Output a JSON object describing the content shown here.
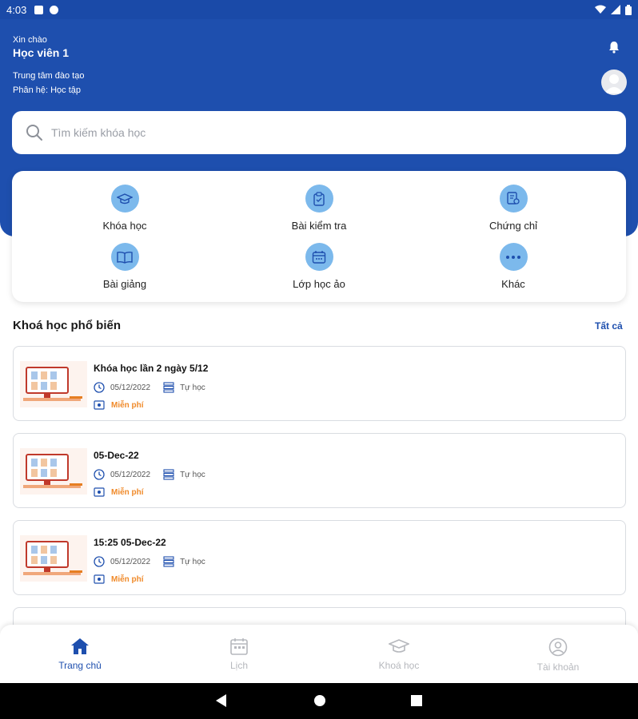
{
  "status_bar": {
    "time": "4:03"
  },
  "header": {
    "greeting": "Xin chào",
    "username": "Học viên 1",
    "center": "Trung tâm đào tạo",
    "department": "Phân hệ: Học tập"
  },
  "search": {
    "placeholder": "Tìm kiếm khóa học"
  },
  "menu": [
    {
      "label": "Khóa học",
      "icon": "graduation-cap-icon"
    },
    {
      "label": "Bài kiểm tra",
      "icon": "clipboard-check-icon"
    },
    {
      "label": "Chứng chỉ",
      "icon": "certificate-icon"
    },
    {
      "label": "Bài giảng",
      "icon": "open-book-icon"
    },
    {
      "label": "Lớp học ảo",
      "icon": "calendar-icon"
    },
    {
      "label": "Khác",
      "icon": "more-dots-icon"
    }
  ],
  "popular": {
    "title": "Khoá học phổ biến",
    "see_all": "Tất cả",
    "courses": [
      {
        "name": "Khóa học lần 2 ngày 5/12",
        "date": "05/12/2022",
        "type": "Tự học",
        "price": "Miễn phí"
      },
      {
        "name": "05-Dec-22",
        "date": "05/12/2022",
        "type": "Tự học",
        "price": "Miễn phí"
      },
      {
        "name": "15:25 05-Dec-22",
        "date": "05/12/2022",
        "type": "Tự học",
        "price": "Miễn phí"
      }
    ]
  },
  "bottom_nav": [
    {
      "label": "Trang chủ",
      "icon": "home-icon",
      "active": true
    },
    {
      "label": "Lịch",
      "icon": "calendar-icon",
      "active": false
    },
    {
      "label": "Khoá học",
      "icon": "graduation-cap-icon",
      "active": false
    },
    {
      "label": "Tài khoản",
      "icon": "account-icon",
      "active": false
    }
  ],
  "colors": {
    "primary": "#1e4fae",
    "accent_light": "#7cb9ec",
    "price": "#f08a2a"
  }
}
